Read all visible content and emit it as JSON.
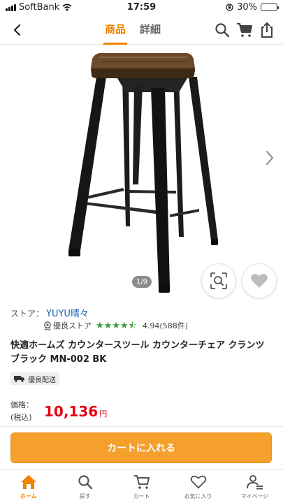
{
  "status_bar": {
    "carrier": "SoftBank",
    "time": "17:59",
    "battery": "30%",
    "battery_level": 0.3
  },
  "header": {
    "tabs": [
      {
        "label": "商品",
        "active": true
      },
      {
        "label": "詳細",
        "active": false
      }
    ],
    "icons": [
      "back-icon",
      "search-icon",
      "cart-icon",
      "share-icon"
    ]
  },
  "gallery": {
    "counter": "1/9"
  },
  "store": {
    "label": "ストア：",
    "name": "YUYU晴々",
    "badge": "優良ストア",
    "rating": 4.94,
    "rating_text": "4.94(588件)",
    "stars_colour": "#3a9b3a"
  },
  "product": {
    "title": "快適ホームズ カウンタースツール カウンターチェア クランツ ブラック MN-002 BK",
    "delivery_badge": "優良配送",
    "price_label": "価格：",
    "price_tax": "(税込)",
    "price": "10,136",
    "price_unit": "円"
  },
  "cart_button": {
    "label": "カートに入れる"
  },
  "colors": {
    "accent": "#f08300",
    "cart_button": "#f5a02c",
    "price": "#e60012",
    "link": "#1a5fb4"
  },
  "tabbar": {
    "items": [
      {
        "label": "ホーム",
        "icon": "home-icon",
        "active": true
      },
      {
        "label": "探す",
        "icon": "search-icon",
        "active": false
      },
      {
        "label": "カート",
        "icon": "cart-icon",
        "active": false
      },
      {
        "label": "お気に入り",
        "icon": "heart-icon",
        "active": false
      },
      {
        "label": "マイページ",
        "icon": "mypage-icon",
        "active": false
      }
    ]
  }
}
